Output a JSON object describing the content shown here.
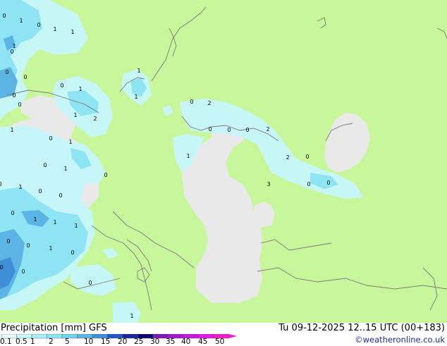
{
  "map": {
    "value_labels": [
      "0",
      "1",
      "0",
      "1",
      "1",
      "1",
      "0",
      "0",
      "0",
      "0",
      "1",
      "0",
      "0",
      "1",
      "2",
      "1",
      "0",
      "1",
      "1",
      "0",
      "0",
      "0",
      "0",
      "1",
      "0",
      "0",
      "1",
      "1",
      "1",
      "0",
      "0",
      "1",
      "0",
      "0",
      "0",
      "0",
      "1",
      "1",
      "1",
      "0",
      "2",
      "0",
      "0",
      "0",
      "2",
      "1",
      "2",
      "0",
      "3",
      "0",
      "0",
      "0"
    ],
    "colors": {
      "land": "#c8f79b",
      "no_data_grey": "#e9e9e9",
      "precip_light": "#c6f7fb",
      "precip_medium": "#8ee4f2",
      "precip_heavy": "#5cb4e4",
      "precip_very_heavy": "#3f8fd8",
      "border_line": "#7a7a7a"
    }
  },
  "footer": {
    "title": "Precipitation [mm] GFS",
    "datetime": "Tu 09-12-2025 12..15 UTC (00+183)",
    "credit": "©weatheronline.co.uk",
    "legend_ticks": [
      "0.1",
      "0.5",
      "1",
      "2",
      "5",
      "10",
      "15",
      "20",
      "25",
      "30",
      "35",
      "40",
      "45",
      "50"
    ],
    "legend_colors": [
      "#e6fbfd",
      "#c6f7fb",
      "#a8eff7",
      "#8ee4f2",
      "#72d4ee",
      "#5cb4e4",
      "#3f8fd8",
      "#2457c6",
      "#15279c",
      "#0a0a6e",
      "#7c1ab4",
      "#a21acb",
      "#c41ad9",
      "#e21ae6",
      "#f020c8"
    ]
  }
}
